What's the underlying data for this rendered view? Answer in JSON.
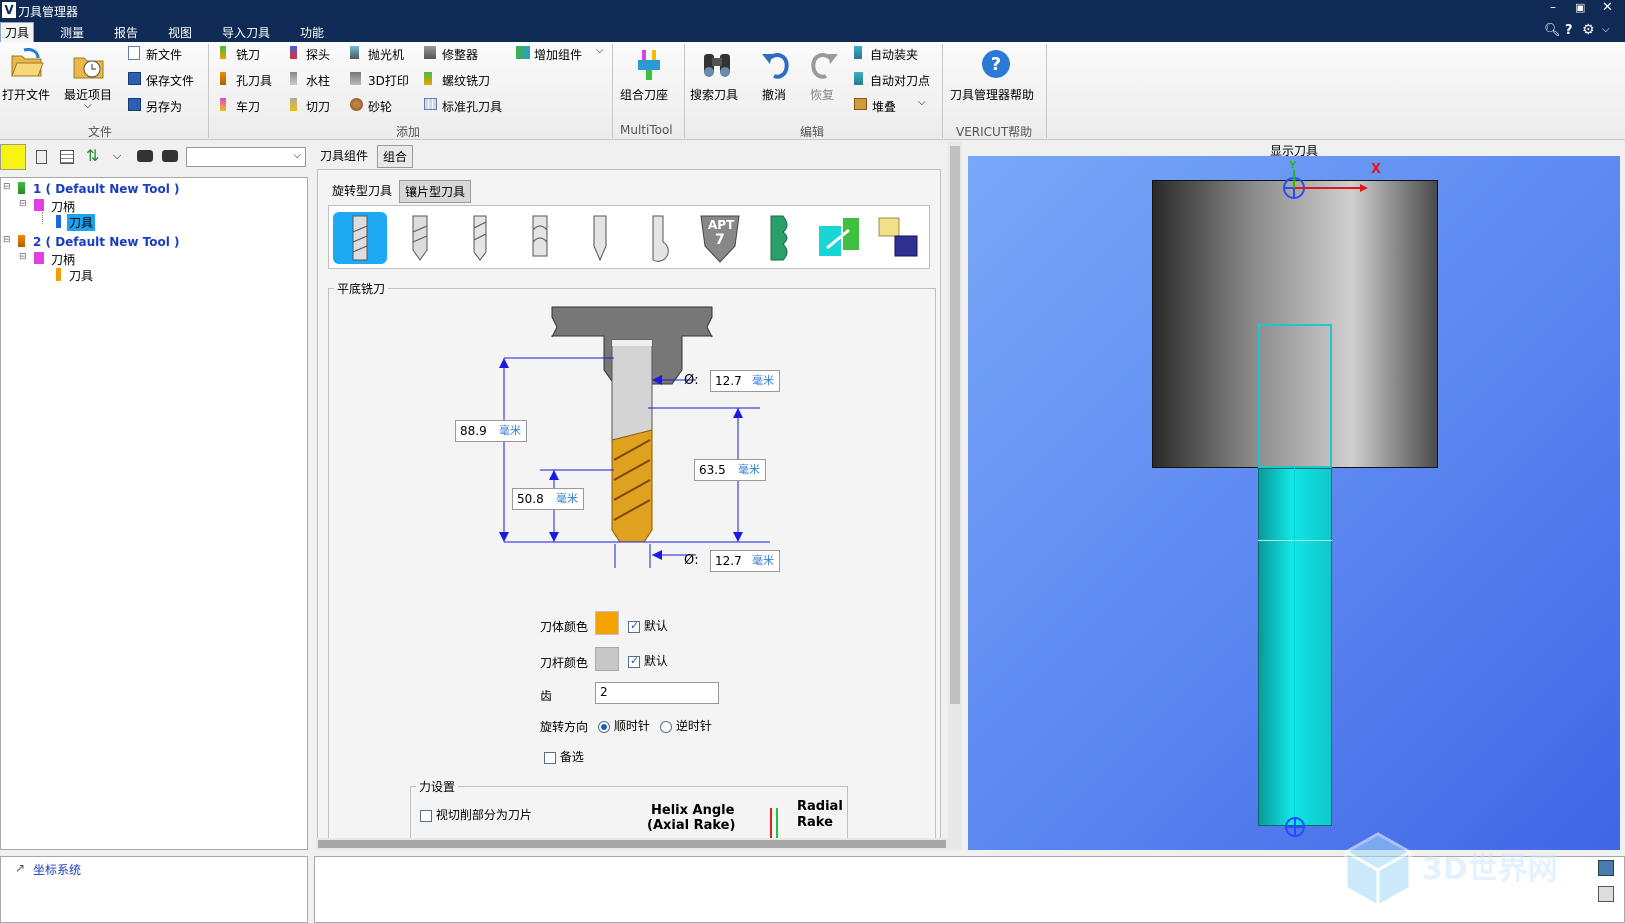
{
  "window": {
    "title": "刀具管理器",
    "logo": "V"
  },
  "menu": [
    "刀具",
    "测量",
    "报告",
    "视图",
    "导入刀具",
    "功能"
  ],
  "ribbon": {
    "file": {
      "open": "打开文件",
      "recent": "最近项目",
      "new": "新文件",
      "save": "保存文件",
      "saveas": "另存为",
      "group": "文件"
    },
    "add": {
      "mill": "铣刀",
      "probe": "探头",
      "polisher": "抛光机",
      "dresser": "修整器",
      "addcomp": "增加组件",
      "hole": "孔刀具",
      "waterjet": "水柱",
      "print3d": "3D打印",
      "thread": "螺纹铣刀",
      "lathe": "车刀",
      "cutoff": "切刀",
      "wheel": "砂轮",
      "stdhole": "标准孔刀具",
      "group": "添加"
    },
    "multitool": {
      "combo": "组合刀座",
      "group": "MultiTool"
    },
    "edit": {
      "search": "搜索刀具",
      "undo": "撤消",
      "redo": "恢复",
      "autoclamp": "自动装夹",
      "autoset": "自动对刀点",
      "stack": "堆叠",
      "group": "编辑"
    },
    "help": {
      "label": "刀具管理器帮助",
      "group": "VERICUT帮助"
    }
  },
  "tree": {
    "items": [
      {
        "num": "1",
        "name": "( Default New Tool )"
      },
      {
        "label": "刀柄"
      },
      {
        "label": "刀具"
      },
      {
        "num": "2",
        "name": "( Default New Tool )"
      },
      {
        "label": "刀柄"
      },
      {
        "label": "刀具"
      }
    ],
    "coord": "坐标系统"
  },
  "center": {
    "tabs": [
      "刀具组件",
      "组合"
    ],
    "subtabs": [
      "旋转型刀具",
      "镶片型刀具"
    ],
    "section": "平底铣刀",
    "apt": "APT",
    "apt_num": "7",
    "dims": {
      "dia_top": "12.7",
      "len_total": "88.9",
      "len_flute": "63.5",
      "len_cut": "50.8",
      "dia_bot": "12.7",
      "unit": "毫米",
      "dia_symbol": "Ø:"
    },
    "body_color_label": "刀体颜色",
    "shank_color_label": "刀杆颜色",
    "default_label": "默认",
    "body_color": "#f5a300",
    "shank_color": "#c8c8c8",
    "teeth_label": "齿",
    "teeth": "2",
    "rotation_label": "旋转方向",
    "cw": "顺时针",
    "ccw": "逆时针",
    "alternate": "备选",
    "force": {
      "title": "力设置",
      "check": "视切削部分为刀片",
      "helix1": "Helix Angle",
      "helix2": "(Axial Rake)",
      "radial1": "Radial",
      "radial2": "Rake"
    }
  },
  "viewport": {
    "title": "显示刀具",
    "axis_x": "X",
    "axis_y": "Y"
  },
  "watermark": "3D世界网"
}
